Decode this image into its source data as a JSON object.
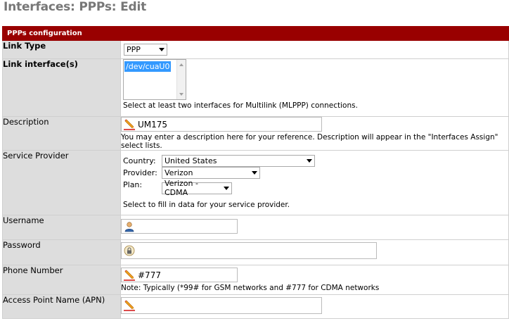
{
  "page": {
    "title": "Interfaces: PPPs: Edit"
  },
  "section": {
    "header": "PPPs configuration"
  },
  "link_type": {
    "label": "Link Type",
    "value": "PPP"
  },
  "link_interfaces": {
    "label": "Link interface(s)",
    "selected_option": "/dev/cuaU0",
    "note": "Select at least two interfaces for Multilink (MLPPP) connections."
  },
  "description": {
    "label": "Description",
    "value": "UM175",
    "note": "You may enter a description here for your reference. Description will appear in the \"Interfaces Assign\" select lists."
  },
  "service_provider": {
    "label": "Service Provider",
    "country_label": "Country:",
    "country_value": "United States",
    "provider_label": "Provider:",
    "provider_value": "Verizon",
    "plan_label": "Plan:",
    "plan_value": "Verizon - CDMA",
    "note": "Select to fill in data for your service provider."
  },
  "username": {
    "label": "Username",
    "value": ""
  },
  "password": {
    "label": "Password",
    "value": ""
  },
  "phone_number": {
    "label": "Phone Number",
    "value": "#777",
    "note": "Note: Typically (*99# for GSM networks and #777 for CDMA networks"
  },
  "apn": {
    "label": "Access Point Name (APN)",
    "value": ""
  },
  "colors": {
    "header_bg": "#990000",
    "label_bg": "#dddddd",
    "selection": "#3399ff"
  }
}
